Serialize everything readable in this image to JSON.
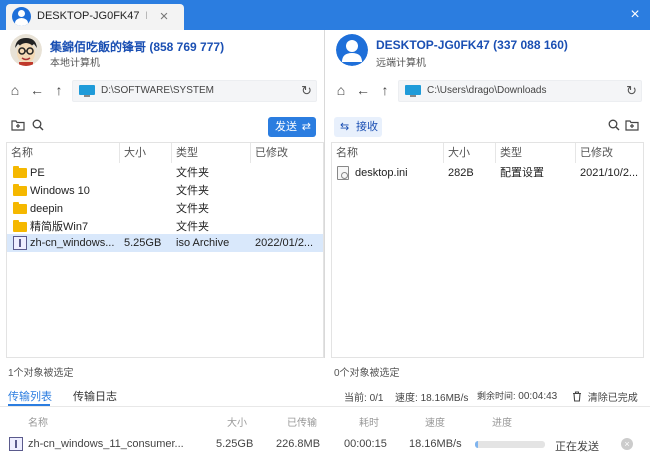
{
  "window": {
    "tab_title": "DESKTOP-JG0FK47",
    "tab_title_suffix": "P",
    "tab_close": "×",
    "close": "×"
  },
  "local": {
    "name": "集錦佰吃飯的锋哥 (858 769 777)",
    "subtitle": "本地计算机",
    "path": "D:\\SOFTWARE\\SYSTEM",
    "send_label": "发送",
    "columns": [
      "名称",
      "大小",
      "类型",
      "已修改"
    ],
    "files": [
      {
        "name": "PE",
        "size": "",
        "type": "文件夹",
        "modified": "",
        "icon": "folder-icon"
      },
      {
        "name": "Windows 10",
        "size": "",
        "type": "文件夹",
        "modified": "",
        "icon": "folder-icon"
      },
      {
        "name": "deepin",
        "size": "",
        "type": "文件夹",
        "modified": "",
        "icon": "folder-icon"
      },
      {
        "name": "精简版Win7",
        "size": "",
        "type": "文件夹",
        "modified": "",
        "icon": "folder-icon"
      },
      {
        "name": "zh-cn_windows...",
        "size": "5.25GB",
        "type": "iso Archive",
        "modified": "2022/01/2...",
        "icon": "archive-icon"
      }
    ],
    "status": "1个对象被选定"
  },
  "remote": {
    "name": "DESKTOP-JG0FK47 (337 088 160)",
    "subtitle": "远端计算机",
    "path": "C:\\Users\\drago\\Downloads",
    "receive_label": "接收",
    "columns": [
      "名称",
      "大小",
      "类型",
      "已修改"
    ],
    "files": [
      {
        "name": "desktop.ini",
        "size": "282B",
        "type": "配置设置",
        "modified": "2021/10/2...",
        "icon": "settings-file-icon"
      }
    ],
    "status": "0个对象被选定"
  },
  "transfer": {
    "tabs": [
      "传输列表",
      "传输日志"
    ],
    "current_label": "当前:",
    "current_value": "0/1",
    "speed_label": "速度:",
    "speed_value": "18.16MB/s",
    "remaining_label": "剩余时间:",
    "remaining_value": "00:04:43",
    "clear_label": "清除已完成",
    "columns": [
      "名称",
      "大小",
      "已传输",
      "耗时",
      "速度",
      "进度"
    ],
    "row": {
      "name": "zh-cn_windows_11_consumer...",
      "size": "5.25GB",
      "transferred": "226.8MB",
      "elapsed": "00:00:15",
      "speed": "18.16MB/s",
      "progress": 0.04,
      "state": "正在发送"
    }
  },
  "colors": {
    "accent": "#2b7de0",
    "selected_row": "#d9e8fb"
  }
}
